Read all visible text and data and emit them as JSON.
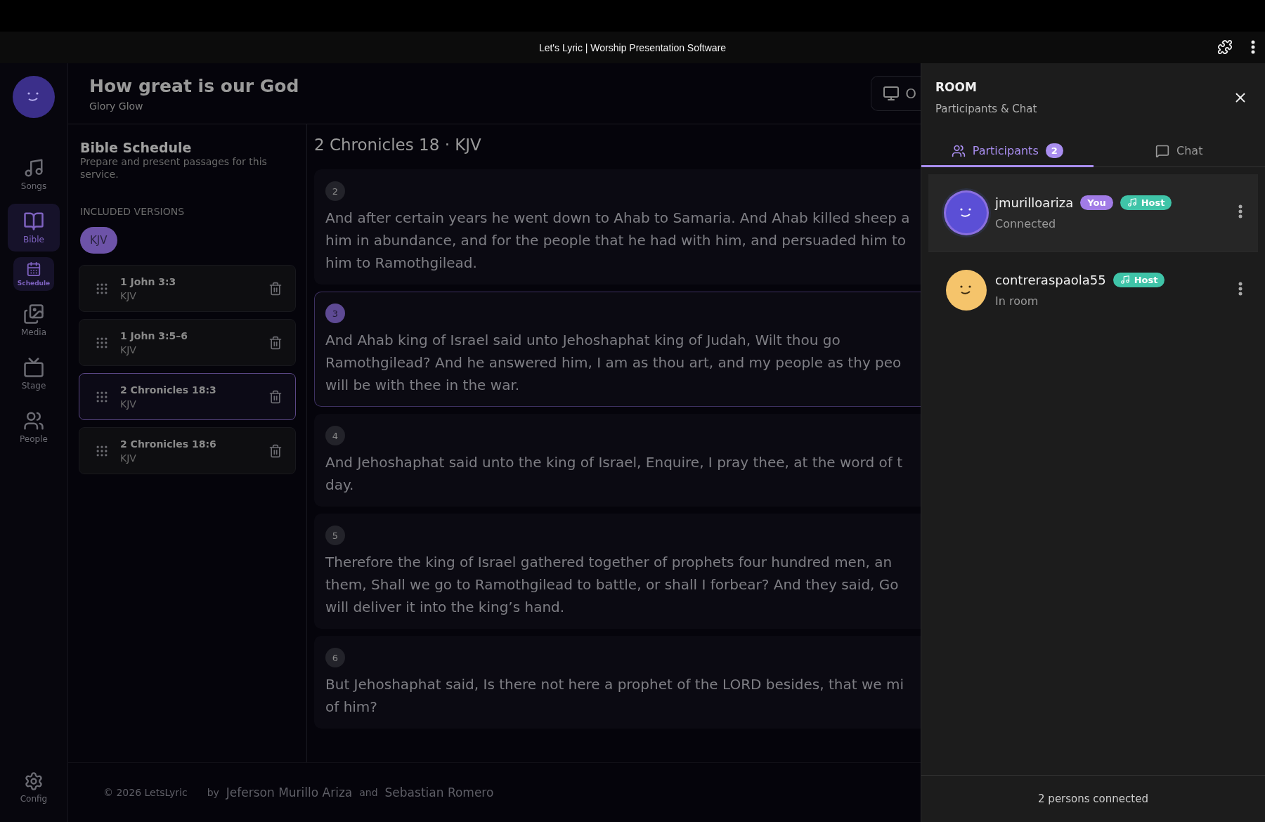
{
  "window": {
    "title": "Let's Lyric | Worship Presentation Software"
  },
  "sidebar": {
    "items": [
      {
        "label": "Songs",
        "kind": "main",
        "selected": false
      },
      {
        "label": "Bible",
        "kind": "main",
        "selected": true
      },
      {
        "label": "Schedule",
        "kind": "sub",
        "selected": true
      },
      {
        "label": "Media",
        "kind": "main",
        "selected": false
      },
      {
        "label": "Stage",
        "kind": "main",
        "selected": false
      },
      {
        "label": "People",
        "kind": "main",
        "selected": false
      }
    ],
    "config": "Config"
  },
  "header": {
    "title": "How great is our God",
    "subtitle": "Glory Glow",
    "button": "O"
  },
  "schedule": {
    "title": "Bible Schedule",
    "description": "Prepare and present passages for this service.",
    "versions_label": "INCLUDED VERSIONS",
    "versions": [
      "KJV"
    ],
    "items": [
      {
        "reference": "1 John 3:3",
        "version": "KJV",
        "selected": false
      },
      {
        "reference": "1 John 3:5–6",
        "version": "KJV",
        "selected": false
      },
      {
        "reference": "2 Chronicles 18:3",
        "version": "KJV",
        "selected": true
      },
      {
        "reference": "2 Chronicles 18:6",
        "version": "KJV",
        "selected": false
      }
    ]
  },
  "passage": {
    "title": "2 Chronicles 18 · KJV",
    "verses": [
      {
        "number": "2",
        "selected": false,
        "lines": [
          "And after certain years he went down to Ahab to Samaria. And Ahab killed sheep a",
          "him in abundance, and for the people that he had with him, and persuaded him to",
          "him to Ramothgilead."
        ]
      },
      {
        "number": "3",
        "selected": true,
        "lines": [
          "And Ahab king of Israel said unto Jehoshaphat king of Judah, Wilt thou go",
          "Ramothgilead? And he answered him, I am as thou art, and my people as thy peo",
          "will be with thee in the war."
        ]
      },
      {
        "number": "4",
        "selected": false,
        "lines": [
          "And Jehoshaphat said unto the king of Israel, Enquire, I pray thee, at the word of t",
          "day."
        ]
      },
      {
        "number": "5",
        "selected": false,
        "lines": [
          "Therefore the king of Israel gathered together of prophets four hundred men, an",
          "them, Shall we go to Ramothgilead to battle, or shall I forbear? And they said, Go",
          "will deliver it into the king’s hand."
        ]
      },
      {
        "number": "6",
        "selected": false,
        "lines": [
          "But Jehoshaphat said, Is there not here a prophet of the LORD besides, that we mi",
          "of him?"
        ]
      }
    ]
  },
  "footer": {
    "copyright": "© 2026 LetsLyric",
    "by": "by",
    "author_1": "Jeferson Murillo Ariza",
    "and": "and",
    "author_2": "Sebastian Romero"
  },
  "room": {
    "title": "ROOM",
    "subtitle": "Participants & Chat",
    "tabs": [
      {
        "label": "Participants",
        "count": "2",
        "kind": "participants",
        "selected": true
      },
      {
        "label": "Chat",
        "kind": "chat",
        "selected": false
      }
    ],
    "participants": [
      {
        "name": "jmurilloariza",
        "status": "Connected",
        "color": "#5b4fd6",
        "selected": true,
        "badges": [
          {
            "label": "You",
            "kind": "you"
          },
          {
            "label": "Host",
            "kind": "host"
          }
        ]
      },
      {
        "name": "contreraspaola55",
        "status": "In room",
        "color": "#f5c46b",
        "selected": false,
        "badges": [
          {
            "label": "Host",
            "kind": "host"
          }
        ]
      }
    ],
    "footer": "2 persons connected"
  }
}
